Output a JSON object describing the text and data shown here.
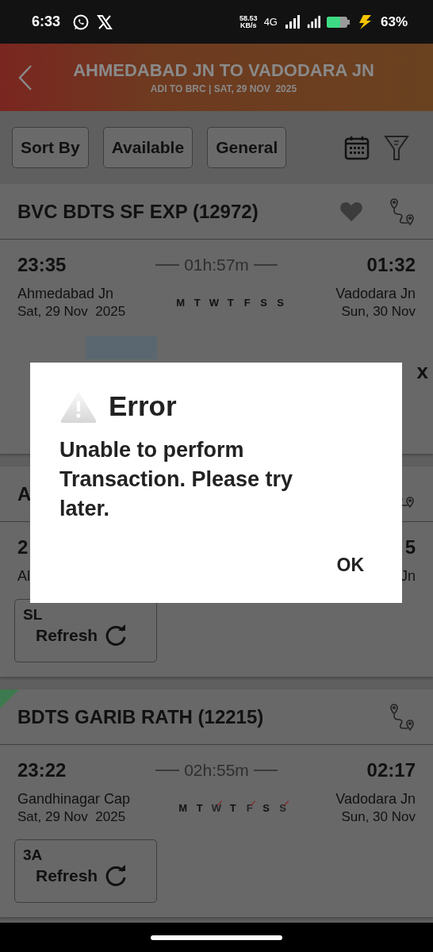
{
  "status_bar": {
    "time": "6:33",
    "speed": "58.53",
    "speed_unit": "KB/s",
    "network": "4G",
    "battery": "63%"
  },
  "header": {
    "title": "AHMEDABAD JN TO VADODARA JN",
    "subtitle": "ADI TO BRC | SAT, 29 NOV  2025"
  },
  "filters": [
    "Sort By",
    "Available",
    "General"
  ],
  "trains": [
    {
      "title": "BVC BDTS SF EXP (12972)",
      "favorite": false,
      "flagged": false,
      "dep_time": "23:35",
      "duration": "01h:57m",
      "arr_time": "01:32",
      "from": "Ahmedabad Jn",
      "dep_date": "Sat, 29 Nov  2025",
      "to": "Vadodara Jn",
      "arr_date": "Sun, 30 Nov",
      "days": [
        {
          "label": "M",
          "runs": true
        },
        {
          "label": "T",
          "runs": true
        },
        {
          "label": "W",
          "runs": true
        },
        {
          "label": "T",
          "runs": true
        },
        {
          "label": "F",
          "runs": true
        },
        {
          "label": "S",
          "runs": true
        },
        {
          "label": "S",
          "runs": true
        }
      ],
      "mark": "x"
    },
    {
      "title": "A",
      "flagged": false,
      "dep_time": "2",
      "arr_time": "5",
      "from": "Al",
      "to": "Jn",
      "classes": [
        {
          "code": "SL",
          "action": "Refresh"
        }
      ]
    },
    {
      "title": "BDTS GARIB RATH (12215)",
      "flagged": true,
      "dep_time": "23:22",
      "duration": "02h:55m",
      "arr_time": "02:17",
      "from": "Gandhinagar Cap",
      "dep_date": "Sat, 29 Nov  2025",
      "to": "Vadodara Jn",
      "arr_date": "Sun, 30 Nov",
      "days": [
        {
          "label": "M",
          "runs": true
        },
        {
          "label": "T",
          "runs": true
        },
        {
          "label": "W",
          "runs": false
        },
        {
          "label": "T",
          "runs": true
        },
        {
          "label": "F",
          "runs": false
        },
        {
          "label": "S",
          "runs": true
        },
        {
          "label": "S",
          "runs": false
        }
      ],
      "classes": [
        {
          "code": "3A",
          "action": "Refresh"
        }
      ]
    }
  ],
  "dialog": {
    "title": "Error",
    "message": "Unable to perform Transaction. Please try later.",
    "button": "OK"
  }
}
